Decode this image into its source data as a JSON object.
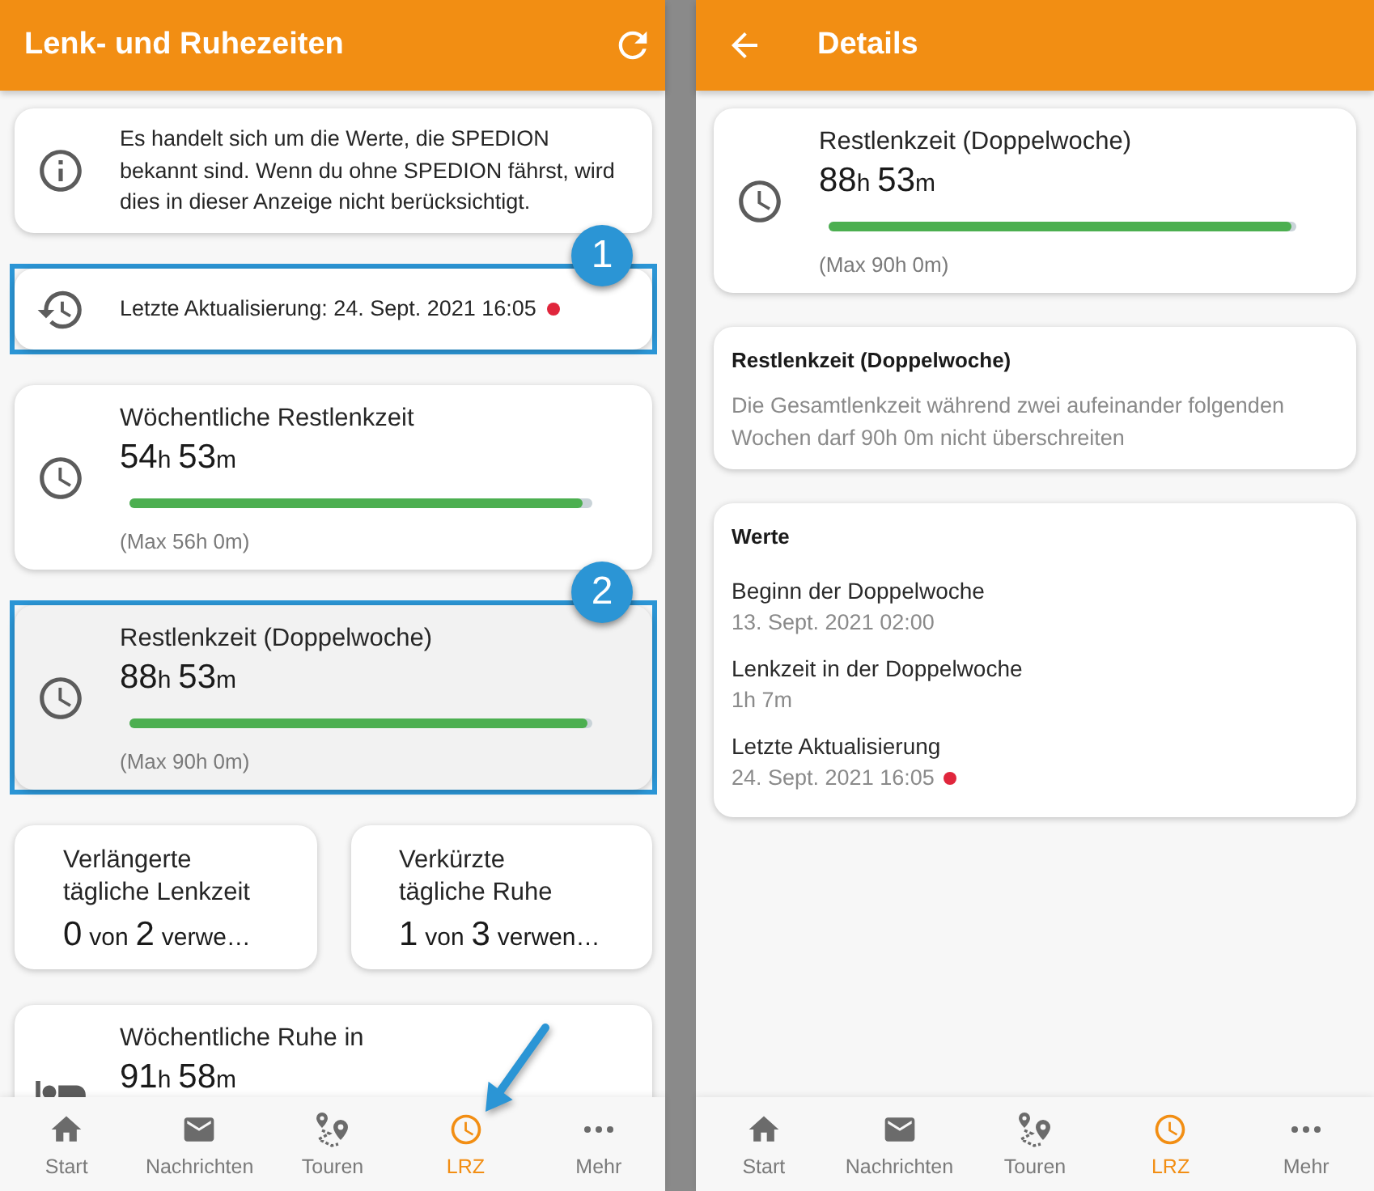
{
  "screens": [
    {
      "header": {
        "kind": "main",
        "title": "Lenk- und Ruhezeiten"
      },
      "cards": [
        {
          "kind": "info",
          "text": "Es handelt sich um die Werte, die SPEDION bekannt sind. Wenn du ohne SPEDION fährst, wird dies in dieser Anzeige nicht berücksichtigt."
        },
        {
          "kind": "update",
          "text": "Letzte Aktualisierung: 24. Sept. 2021 16:05",
          "color": "#e0263c",
          "callout": "1"
        },
        {
          "kind": "meter",
          "title": "Wöchentliche Restlenkzeit",
          "value": [
            {
              "amount": "54",
              "unit": "h"
            },
            {
              "amount": "53",
              "unit": "m"
            }
          ],
          "level": 0.98,
          "max": "(Max 56h 0m)",
          "selected": false
        },
        {
          "kind": "meter",
          "title": "Restlenkzeit (Doppelwoche)",
          "value": [
            {
              "amount": "88",
              "unit": "h"
            },
            {
              "amount": "53",
              "unit": "m"
            }
          ],
          "level": 0.99,
          "max": "(Max 90h 0m)",
          "selected": true,
          "callout": "2"
        },
        {
          "kind": "pair",
          "items": [
            {
              "title": [
                "Verlängerte",
                "tägliche Lenkzeit"
              ],
              "usage": [
                {
                  "amount": "0",
                  "unit": "von"
                },
                {
                  "amount": "2",
                  "unit": "verwe…"
                }
              ]
            },
            {
              "title": [
                "Verkürzte",
                "tägliche Ruhe"
              ],
              "usage": [
                {
                  "amount": "1",
                  "unit": "von"
                },
                {
                  "amount": "3",
                  "unit": "verwen…"
                }
              ]
            }
          ]
        },
        {
          "kind": "rest",
          "title": "Wöchentliche Ruhe in",
          "value": [
            {
              "amount": "91",
              "unit": "h"
            },
            {
              "amount": "58",
              "unit": "m"
            }
          ],
          "selected": false
        }
      ],
      "nav": [
        {
          "label": "Start",
          "selected": false,
          "pointed": false
        },
        {
          "label": "Nachrichten",
          "selected": false,
          "pointed": false
        },
        {
          "label": "Touren",
          "selected": false,
          "pointed": false
        },
        {
          "label": "LRZ",
          "selected": true,
          "pointed": true
        },
        {
          "label": "Mehr",
          "selected": false,
          "pointed": false
        }
      ]
    },
    {
      "header": {
        "kind": "detail",
        "title": "Details"
      },
      "cards": [
        {
          "kind": "meter",
          "title": "Restlenkzeit (Doppelwoche)",
          "value": [
            {
              "amount": "88",
              "unit": "h"
            },
            {
              "amount": "53",
              "unit": "m"
            }
          ],
          "level": 0.99,
          "max": "(Max 90h 0m)",
          "selected": false
        },
        {
          "kind": "description",
          "title": "Restlenkzeit (Doppelwoche)",
          "text": "Die Gesamtlenkzeit während zwei aufeinander folgenden Wochen darf 90h 0m nicht überschreiten"
        },
        {
          "kind": "values",
          "title": "Werte",
          "rows": [
            {
              "label": "Beginn der Doppelwoche",
              "value": "13. Sept. 2021 02:00"
            },
            {
              "label": "Lenkzeit in der Doppelwoche",
              "value": "1h 7m"
            },
            {
              "label": "Letzte Aktualisierung",
              "value": "24. Sept. 2021 16:05",
              "color": "#e0263c"
            }
          ]
        }
      ],
      "nav": [
        {
          "label": "Start",
          "selected": false,
          "pointed": false
        },
        {
          "label": "Nachrichten",
          "selected": false,
          "pointed": false
        },
        {
          "label": "Touren",
          "selected": false,
          "pointed": false
        },
        {
          "label": "LRZ",
          "selected": true,
          "pointed": false
        },
        {
          "label": "Mehr",
          "selected": false,
          "pointed": false
        }
      ]
    }
  ]
}
